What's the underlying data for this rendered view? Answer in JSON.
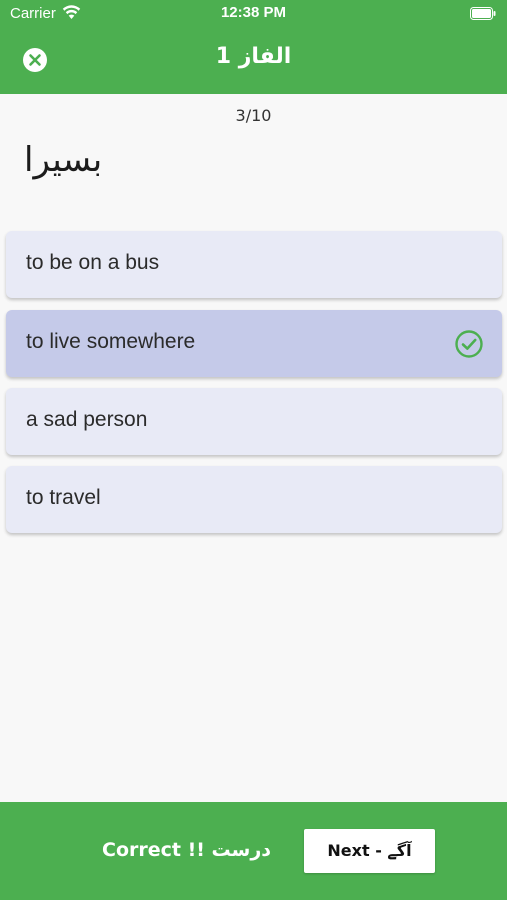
{
  "status_bar": {
    "carrier": "Carrier",
    "time": "12:38 PM",
    "icons": [
      "wifi-icon",
      "battery-icon"
    ]
  },
  "header": {
    "title": "الفاز 1",
    "close_icon": "close-circle-icon"
  },
  "quiz": {
    "progress": "3/10",
    "word": "بسیرا",
    "options": [
      {
        "label": "to be on a bus",
        "selected": false
      },
      {
        "label": "to live somewhere",
        "selected": true,
        "icon": "check-circle-icon"
      },
      {
        "label": "a sad person",
        "selected": false
      },
      {
        "label": "to travel",
        "selected": false
      }
    ]
  },
  "footer": {
    "feedback": "Correct !! درست",
    "next_label": "Next  -  آگے"
  },
  "colors": {
    "primary": "#4caf50",
    "option_bg": "#e8eaf6",
    "option_selected_bg": "#c5cae9",
    "check": "#4caf50"
  }
}
